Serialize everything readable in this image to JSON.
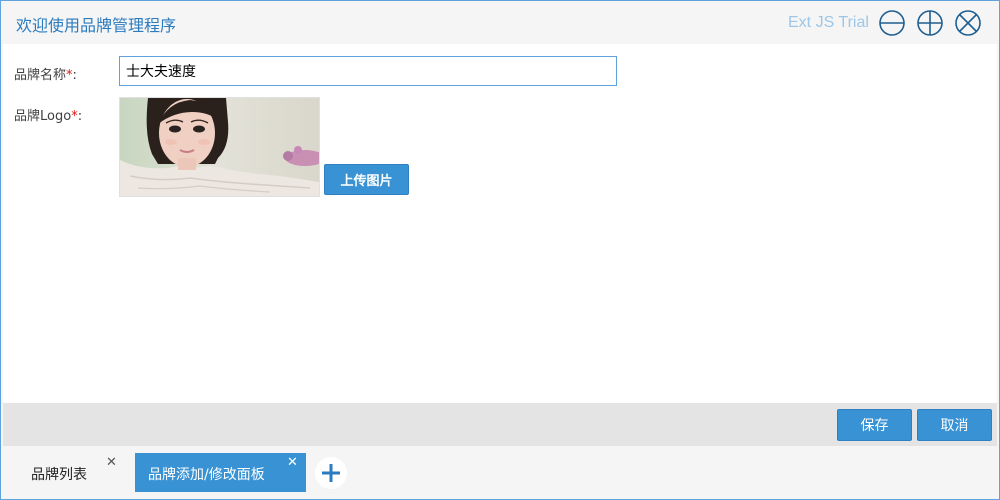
{
  "window": {
    "title": "欢迎使用品牌管理程序",
    "trial_text": "Ext JS Trial",
    "tools": [
      "minimize-icon",
      "maximize-icon",
      "close-icon"
    ]
  },
  "form": {
    "name_label": "品牌名称",
    "logo_label": "品牌Logo",
    "required_mark": "*",
    "label_suffix": ":",
    "name_value": "士大夫速度",
    "upload_label": "上传图片"
  },
  "footer": {
    "save_label": "保存",
    "cancel_label": "取消"
  },
  "tabs": [
    {
      "label": "品牌列表",
      "active": false
    },
    {
      "label": "品牌添加/修改面板",
      "active": true
    }
  ],
  "tab_close_glyph": "✕",
  "add_tab_icon": "plus-icon",
  "colors": {
    "accent": "#3892d4",
    "title": "#2b7bbf",
    "required": "#e01010",
    "border": "#5fa2dd"
  }
}
